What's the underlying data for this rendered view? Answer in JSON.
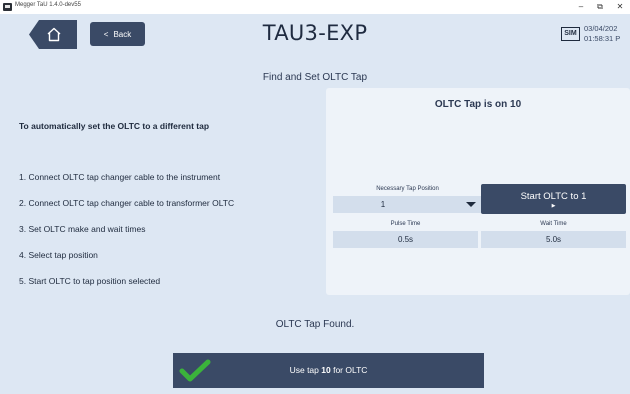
{
  "window": {
    "app_title": "Megger TaU 1.4.0-dev55",
    "minimize_glyph": "–",
    "restore_glyph": "⧉",
    "close_glyph": "✕"
  },
  "nav": {
    "home_icon": "home-icon",
    "back_arrow": "<",
    "back_label": "Back"
  },
  "header": {
    "title": "TAU3-EXP",
    "sim_badge": "SIM",
    "date": "03/04/202",
    "time": "01:58:31 P"
  },
  "subheader": "Find and Set OLTC Tap",
  "instructions": {
    "intro": "To automatically set the OLTC to a different tap",
    "steps": [
      "1. Connect OLTC tap changer cable to the instrument",
      "2. Connect OLTC tap changer cable to transformer OLTC",
      "3. Set OLTC make and wait times",
      "4. Select tap position",
      "5. Start OLTC to tap position selected"
    ]
  },
  "panel": {
    "heading": "OLTC Tap is on 10",
    "necessary_tap_label": "Necessary Tap Position",
    "necessary_tap_value": "1",
    "start_button_label": "Start OLTC to 1",
    "start_button_icon": "▶",
    "pulse_time_label": "Pulse Time",
    "pulse_time_value": "0.5s",
    "wait_time_label": "Wait Time",
    "wait_time_value": "5.0s"
  },
  "status": {
    "message": "OLTC Tap Found."
  },
  "action": {
    "icon": "checkmark-icon",
    "prefix": "Use tap ",
    "tap": "10",
    "suffix": " for OLTC",
    "check_color": "#3bb33b"
  },
  "colors": {
    "background": "#dde7f3",
    "panel": "#eef3f9",
    "button": "#3a4a66",
    "field": "#d3deec"
  }
}
